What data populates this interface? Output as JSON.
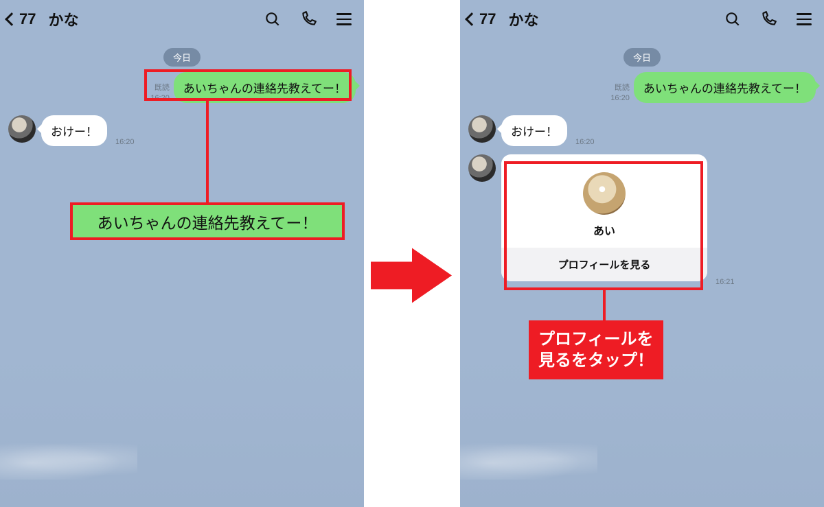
{
  "header": {
    "back_count": "77",
    "chat_name": "かな"
  },
  "chat": {
    "date_label": "今日",
    "out1_read": "既読",
    "out1_time": "16:20",
    "out1_text": "あいちゃんの連絡先教えてー！",
    "in1_text": "おけー！",
    "in1_time": "16:20",
    "zoom_text": "あいちゃんの連絡先教えてー！"
  },
  "card": {
    "contact_name": "あい",
    "button_label": "プロフィールを見る",
    "time": "16:21"
  },
  "callout": {
    "text": "プロフィールを\n見るをタップ！"
  }
}
